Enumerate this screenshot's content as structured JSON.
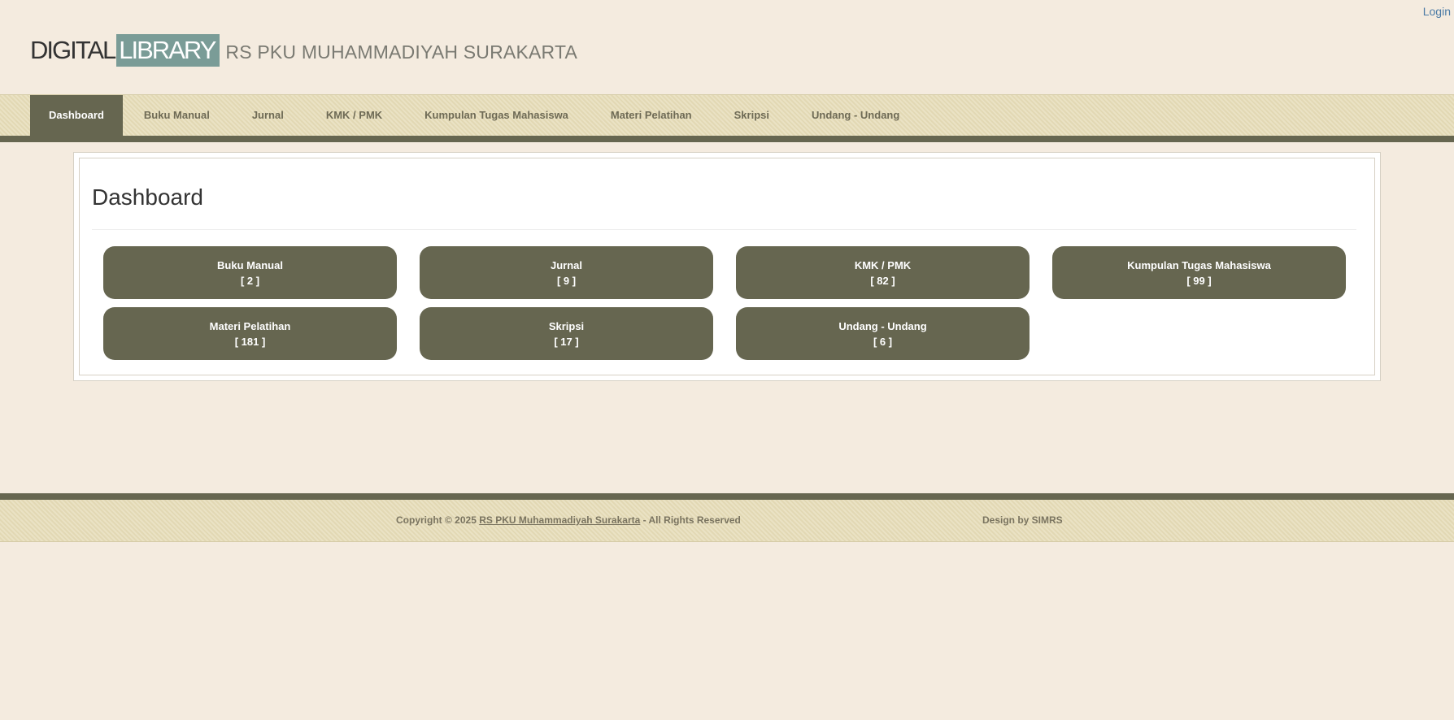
{
  "topbar": {
    "login_label": "Login"
  },
  "header": {
    "logo_part1": "DIGITAL",
    "logo_part2": "LIBRARY",
    "org_name": "RS PKU MUHAMMADIYAH SURAKARTA"
  },
  "nav": {
    "items": [
      {
        "label": "Dashboard",
        "active": true
      },
      {
        "label": "Buku Manual"
      },
      {
        "label": "Jurnal"
      },
      {
        "label": "KMK / PMK"
      },
      {
        "label": "Kumpulan Tugas Mahasiswa"
      },
      {
        "label": "Materi Pelatihan"
      },
      {
        "label": "Skripsi"
      },
      {
        "label": "Undang - Undang"
      }
    ]
  },
  "main": {
    "title": "Dashboard",
    "tiles": [
      {
        "label": "Buku Manual",
        "count": "[ 2 ]"
      },
      {
        "label": "Jurnal",
        "count": "[ 9 ]"
      },
      {
        "label": "KMK / PMK",
        "count": "[ 82 ]"
      },
      {
        "label": "Kumpulan Tugas Mahasiswa",
        "count": "[ 99 ]"
      },
      {
        "label": "Materi Pelatihan",
        "count": "[ 181 ]"
      },
      {
        "label": "Skripsi",
        "count": "[ 17 ]"
      },
      {
        "label": "Undang - Undang",
        "count": "[ 6 ]"
      }
    ]
  },
  "footer": {
    "copyright_prefix": "Copyright © 2025",
    "copyright_link": "RS PKU Muhammadiyah Surakarta",
    "copyright_suffix": "- All Rights Reserved",
    "design_credit": "Design by SIMRS"
  },
  "colors": {
    "accent": "#666650",
    "background": "#f4ebdf",
    "nav_bg": "#e6dcb7",
    "logo_highlight": "#7a9c97",
    "link": "#4a7aa5"
  }
}
